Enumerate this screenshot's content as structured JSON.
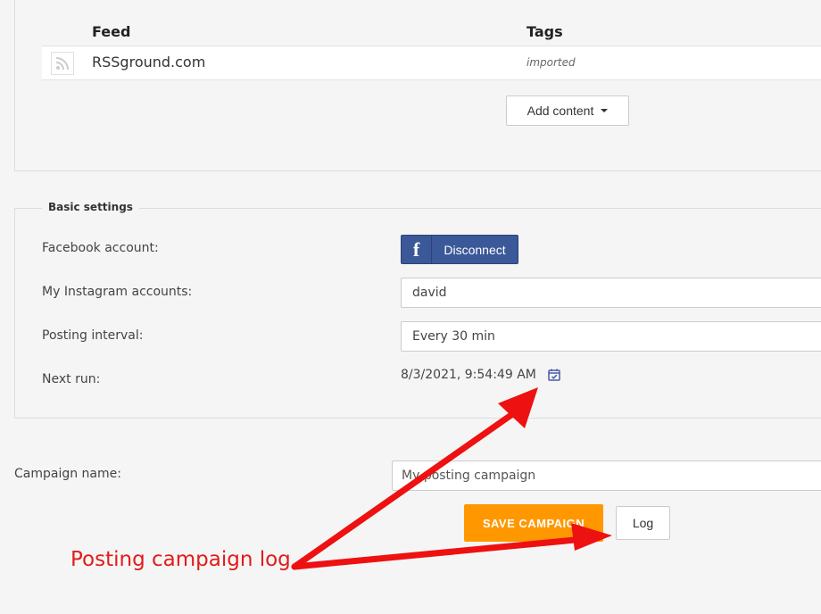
{
  "feeds": {
    "columns": {
      "feed": "Feed",
      "tags": "Tags"
    },
    "rows": [
      {
        "name": "RSSground.com",
        "tag": "imported",
        "icon": "rss-icon"
      }
    ],
    "add_content_label": "Add content"
  },
  "basic_settings": {
    "legend": "Basic settings",
    "facebook_label": "Facebook account:",
    "facebook_button": "Disconnect",
    "instagram_label": "My Instagram accounts:",
    "instagram_value": "david",
    "interval_label": "Posting interval:",
    "interval_value": "Every 30 min",
    "next_run_label": "Next run:",
    "next_run_value": "8/3/2021, 9:54:49 AM"
  },
  "campaign": {
    "name_label": "Campaign name:",
    "name_value": "My posting campaign",
    "save_label": "SAVE CAMPAIGN",
    "log_label": "Log"
  },
  "annotation": {
    "text": "Posting campaign log",
    "color": "#e21b1b"
  },
  "colors": {
    "facebook": "#3b5998",
    "save_button": "#ff9800"
  }
}
